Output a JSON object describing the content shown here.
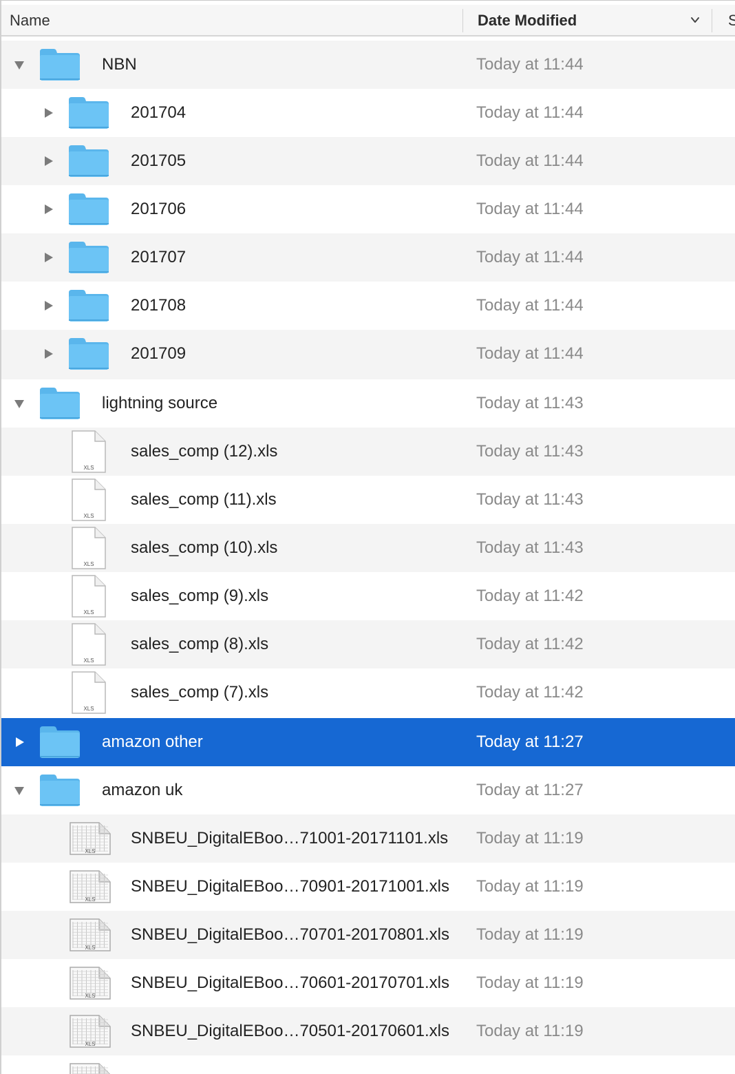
{
  "header": {
    "name_label": "Name",
    "date_label": "Date Modified",
    "size_label_partial": "S",
    "sort_icon": "chevron-down-icon"
  },
  "colors": {
    "selection": "#1668d3",
    "folder": "#6cc4f5",
    "alt_row": "#f4f4f4",
    "date_text": "#8a8a8a"
  },
  "rows": [
    {
      "name": "NBN",
      "date": "Today at 11:44",
      "kind": "folder",
      "level": 0,
      "disclosure": "expanded"
    },
    {
      "name": "201704",
      "date": "Today at 11:44",
      "kind": "folder",
      "level": 1,
      "disclosure": "collapsed"
    },
    {
      "name": "201705",
      "date": "Today at 11:44",
      "kind": "folder",
      "level": 1,
      "disclosure": "collapsed"
    },
    {
      "name": "201706",
      "date": "Today at 11:44",
      "kind": "folder",
      "level": 1,
      "disclosure": "collapsed"
    },
    {
      "name": "201707",
      "date": "Today at 11:44",
      "kind": "folder",
      "level": 1,
      "disclosure": "collapsed"
    },
    {
      "name": "201708",
      "date": "Today at 11:44",
      "kind": "folder",
      "level": 1,
      "disclosure": "collapsed"
    },
    {
      "name": "201709",
      "date": "Today at 11:44",
      "kind": "folder",
      "level": 1,
      "disclosure": "collapsed"
    },
    {
      "name": "lightning source",
      "date": "Today at 11:43",
      "kind": "folder",
      "level": 0,
      "disclosure": "expanded"
    },
    {
      "name": "sales_comp (12).xls",
      "date": "Today at 11:43",
      "kind": "xls-blank",
      "level": 1,
      "disclosure": "none",
      "icon_label": "XLS"
    },
    {
      "name": "sales_comp (11).xls",
      "date": "Today at 11:43",
      "kind": "xls-blank",
      "level": 1,
      "disclosure": "none",
      "icon_label": "XLS"
    },
    {
      "name": "sales_comp (10).xls",
      "date": "Today at 11:43",
      "kind": "xls-blank",
      "level": 1,
      "disclosure": "none",
      "icon_label": "XLS"
    },
    {
      "name": "sales_comp (9).xls",
      "date": "Today at 11:42",
      "kind": "xls-blank",
      "level": 1,
      "disclosure": "none",
      "icon_label": "XLS"
    },
    {
      "name": "sales_comp (8).xls",
      "date": "Today at 11:42",
      "kind": "xls-blank",
      "level": 1,
      "disclosure": "none",
      "icon_label": "XLS"
    },
    {
      "name": "sales_comp (7).xls",
      "date": "Today at 11:42",
      "kind": "xls-blank",
      "level": 1,
      "disclosure": "none",
      "icon_label": "XLS"
    },
    {
      "name": "amazon other",
      "date": "Today at 11:27",
      "kind": "folder",
      "level": 0,
      "disclosure": "collapsed",
      "selected": true
    },
    {
      "name": "amazon uk",
      "date": "Today at 11:27",
      "kind": "folder",
      "level": 0,
      "disclosure": "expanded"
    },
    {
      "name": "SNBEU_DigitalEBoo…71001-20171101.xls",
      "date": "Today at 11:19",
      "kind": "xls-sheet",
      "level": 1,
      "disclosure": "none",
      "icon_label": "XLS"
    },
    {
      "name": "SNBEU_DigitalEBoo…70901-20171001.xls",
      "date": "Today at 11:19",
      "kind": "xls-sheet",
      "level": 1,
      "disclosure": "none",
      "icon_label": "XLS"
    },
    {
      "name": "SNBEU_DigitalEBoo…70701-20170801.xls",
      "date": "Today at 11:19",
      "kind": "xls-sheet",
      "level": 1,
      "disclosure": "none",
      "icon_label": "XLS"
    },
    {
      "name": "SNBEU_DigitalEBoo…70601-20170701.xls",
      "date": "Today at 11:19",
      "kind": "xls-sheet",
      "level": 1,
      "disclosure": "none",
      "icon_label": "XLS"
    },
    {
      "name": "SNBEU_DigitalEBoo…70501-20170601.xls",
      "date": "Today at 11:19",
      "kind": "xls-sheet",
      "level": 1,
      "disclosure": "none",
      "icon_label": "XLS"
    },
    {
      "name": "",
      "date": "",
      "kind": "xls-sheet",
      "level": 1,
      "disclosure": "none",
      "icon_label": ""
    }
  ]
}
